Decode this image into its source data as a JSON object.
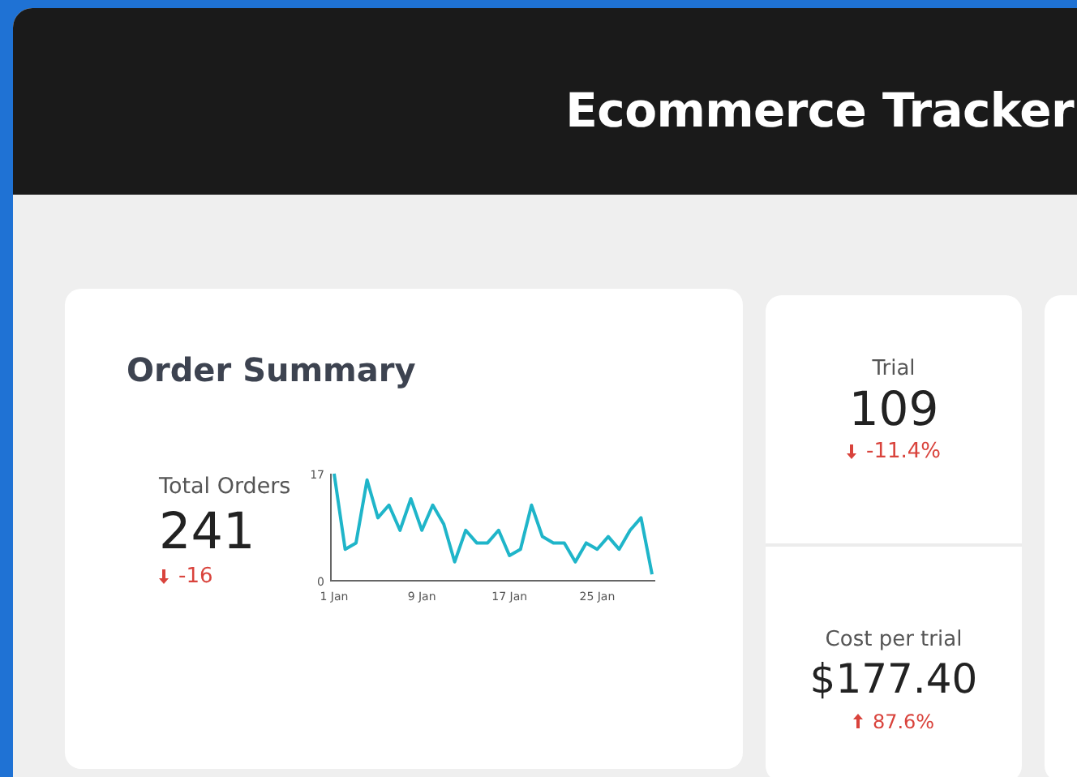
{
  "header": {
    "title": "Ecommerce Tracker"
  },
  "order_summary": {
    "title": "Order Summary",
    "metric": {
      "label": "Total Orders",
      "value": "241",
      "change": "-16",
      "kind": "down"
    },
    "chart_data": {
      "type": "line",
      "categories": [
        "1 Jan",
        null,
        null,
        null,
        null,
        null,
        null,
        null,
        "9 Jan",
        null,
        null,
        null,
        null,
        null,
        null,
        null,
        "17 Jan",
        null,
        null,
        null,
        null,
        null,
        null,
        null,
        "25 Jan",
        null,
        null,
        null,
        null,
        null
      ],
      "series": [
        {
          "color": "#1fb5c9",
          "values": [
            17,
            5,
            6,
            16,
            10,
            12,
            8,
            13,
            8,
            12,
            9,
            3,
            8,
            6,
            6,
            8,
            4,
            5,
            12,
            7,
            6,
            6,
            3,
            6,
            5,
            7,
            5,
            8,
            10,
            1
          ]
        }
      ],
      "ylim": [
        0,
        17
      ],
      "yticks": [
        0,
        17
      ]
    }
  },
  "kpis": [
    {
      "label": "Trial",
      "value": "109",
      "change": "-11.4%",
      "kind": "down"
    },
    {
      "label": "Cost per trial",
      "value": "$177.40",
      "change": "87.6%",
      "kind": "up"
    }
  ]
}
